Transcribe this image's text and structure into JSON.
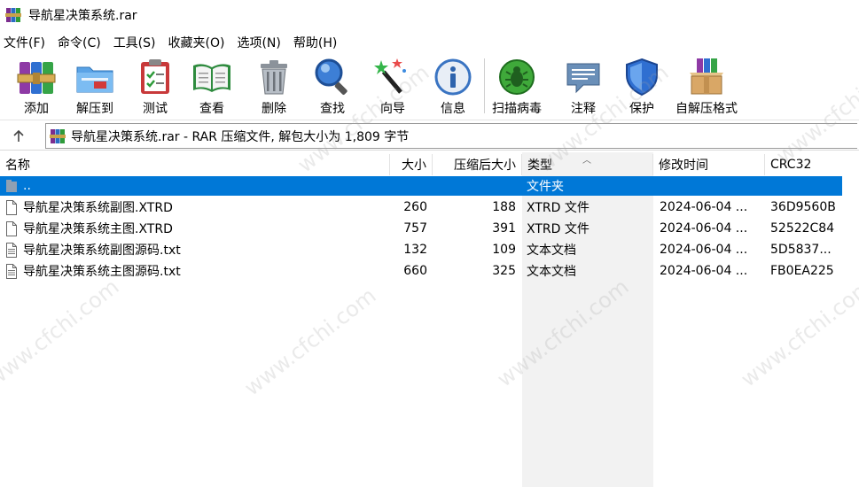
{
  "window": {
    "title": "导航星决策系统.rar"
  },
  "menu": [
    {
      "label": "文件(F)"
    },
    {
      "label": "命令(C)"
    },
    {
      "label": "工具(S)"
    },
    {
      "label": "收藏夹(O)"
    },
    {
      "label": "选项(N)"
    },
    {
      "label": "帮助(H)"
    }
  ],
  "toolbar": [
    {
      "label": "添加",
      "icon": "add-books-icon"
    },
    {
      "label": "解压到",
      "icon": "extract-folder-icon"
    },
    {
      "label": "测试",
      "icon": "test-clipboard-icon"
    },
    {
      "label": "查看",
      "icon": "view-book-icon"
    },
    {
      "label": "删除",
      "icon": "trash-icon"
    },
    {
      "label": "查找",
      "icon": "magnifier-icon"
    },
    {
      "label": "向导",
      "icon": "wizard-wand-icon"
    },
    {
      "label": "信息",
      "icon": "info-icon"
    },
    {
      "label": "扫描病毒",
      "icon": "virus-scan-icon"
    },
    {
      "label": "注释",
      "icon": "comment-icon"
    },
    {
      "label": "保护",
      "icon": "shield-icon"
    },
    {
      "label": "自解压格式",
      "icon": "sfx-box-icon"
    }
  ],
  "address": {
    "text": "导航星决策系统.rar - RAR 压缩文件, 解包大小为 1,809 字节"
  },
  "columns": {
    "name": "名称",
    "size": "大小",
    "packed": "压缩后大小",
    "type": "类型",
    "modified": "修改时间",
    "crc": "CRC32"
  },
  "rows": [
    {
      "name": "..",
      "size": "",
      "packed": "",
      "type": "文件夹",
      "modified": "",
      "crc": "",
      "icon": "parent-folder-icon",
      "selected": true
    },
    {
      "name": "导航星决策系统副图.XTRD",
      "size": "260",
      "packed": "188",
      "type": "XTRD 文件",
      "modified": "2024-06-04 ...",
      "crc": "36D9560B",
      "icon": "file-icon",
      "selected": false
    },
    {
      "name": "导航星决策系统主图.XTRD",
      "size": "757",
      "packed": "391",
      "type": "XTRD 文件",
      "modified": "2024-06-04 ...",
      "crc": "52522C84",
      "icon": "file-icon",
      "selected": false
    },
    {
      "name": "导航星决策系统副图源码.txt",
      "size": "132",
      "packed": "109",
      "type": "文本文档",
      "modified": "2024-06-04 ...",
      "crc": "5D5837...",
      "icon": "text-file-icon",
      "selected": false
    },
    {
      "name": "导航星决策系统主图源码.txt",
      "size": "660",
      "packed": "325",
      "type": "文本文档",
      "modified": "2024-06-04 ...",
      "crc": "FB0EA225",
      "icon": "text-file-icon",
      "selected": false
    }
  ],
  "watermark": "www.cfchi.com"
}
